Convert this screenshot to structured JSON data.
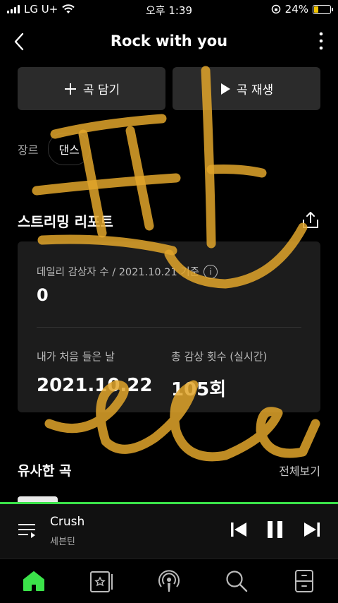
{
  "status_bar": {
    "carrier": "LG U+",
    "time": "오후 1:39",
    "battery": "24%"
  },
  "header": {
    "title": "Rock with you"
  },
  "actions": {
    "add_label": "곡 담기",
    "play_label": "곡 재생"
  },
  "genre": {
    "label": "장르",
    "value": "댄스"
  },
  "report": {
    "title": "스트리밍 리포트",
    "daily_label": "데일리 감상자 수 / 2021.10.21 기준",
    "daily_value": "0",
    "first_label": "내가 처음 들은 날",
    "first_value": "2021.10.22",
    "total_label": "총 감상 횟수 (실시간)",
    "total_value": "105회"
  },
  "similar": {
    "title": "유사한 곡",
    "see_all": "전체보기"
  },
  "player": {
    "song": "Crush",
    "artist": "세븐틴",
    "progress": 1.0
  },
  "colors": {
    "accent": "#3be34a",
    "battery": "#f0c300",
    "scribble": "#e0a52a"
  },
  "icons": [
    "back-icon",
    "more-icon",
    "plus-icon",
    "play-icon",
    "share-icon",
    "info-icon",
    "queue-icon",
    "previous-icon",
    "pause-icon",
    "next-icon",
    "home-icon",
    "library-icon",
    "podcast-icon",
    "search-icon",
    "storage-icon"
  ]
}
